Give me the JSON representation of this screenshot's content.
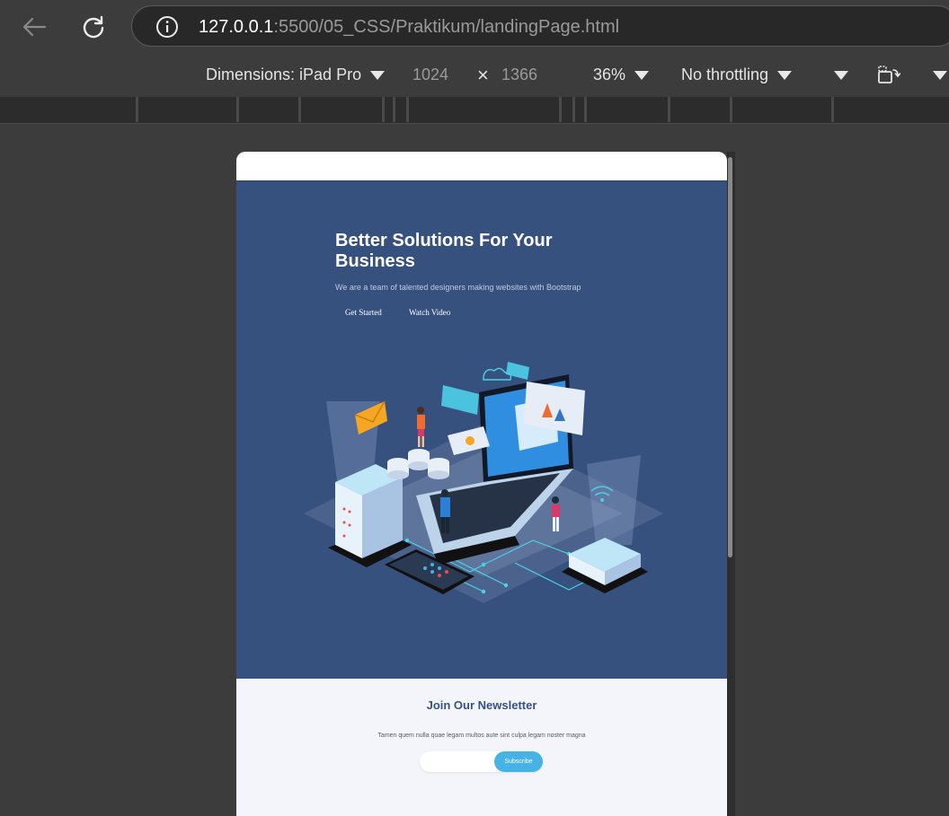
{
  "browser": {
    "url_host": "127.0.0.1",
    "url_rest": ":5500/05_CSS/Praktikum/landingPage.html"
  },
  "devtools": {
    "dimensions_label": "Dimensions: iPad Pro",
    "width_value": "1024",
    "times_symbol": "×",
    "height_value": "1366",
    "zoom": "36%",
    "throttling": "No throttling"
  },
  "hero": {
    "title": "Better Solutions For Your Business",
    "subtitle": "We are a team of talented designers making websites with Bootstrap",
    "get_started": "Get Started",
    "watch_video": "Watch Video"
  },
  "newsletter": {
    "title": "Join Our Newsletter",
    "text": "Tamen quem nulla quae legam multos aute sint culpa legam noster magna",
    "subscribe": "Subscribe"
  },
  "colors": {
    "hero_bg": "#37517e",
    "accent": "#47b2e4",
    "newsletter_bg": "#f3f5fa"
  }
}
